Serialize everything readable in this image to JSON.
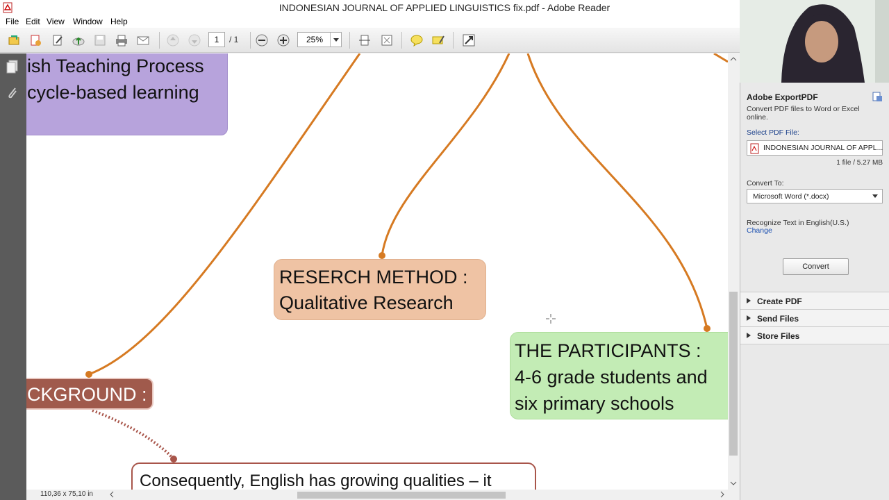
{
  "window": {
    "title": "INDONESIAN JOURNAL OF APPLIED LINGUISTICS fix.pdf - Adobe Reader"
  },
  "menu": [
    "File",
    "Edit",
    "View",
    "Window",
    "Help"
  ],
  "toolbar": {
    "page_current": "1",
    "page_total": "/ 1",
    "zoom": "25%"
  },
  "document": {
    "node_top_left_line1": "ish Teaching Process",
    "node_top_left_line2": "cycle-based learning",
    "research_method_line1": "RESERCH METHOD :",
    "research_method_line2": "Qualitative Research",
    "participants_line1": "THE PARTICIPANTS :",
    "participants_line2": "4-6 grade students and",
    "participants_line3": "six primary schools",
    "background_label": "CKGROUND :",
    "bottom_text": "Consequently, English has growing qualities – it"
  },
  "status": {
    "page_size": "110,36 x 75,10 in"
  },
  "panel": {
    "export_title": "Adobe ExportPDF",
    "export_desc": "Convert PDF files to Word or Excel online.",
    "select_label": "Select PDF File:",
    "selected_file": "INDONESIAN JOURNAL OF APPL...",
    "file_info": "1 file / 5.27 MB",
    "convert_to_label": "Convert To:",
    "convert_to_value": "Microsoft Word (*.docx)",
    "recognize_text": "Recognize Text in English(U.S.)",
    "change_link": "Change",
    "convert_button": "Convert",
    "sections": [
      "Create PDF",
      "Send Files",
      "Store Files"
    ]
  }
}
